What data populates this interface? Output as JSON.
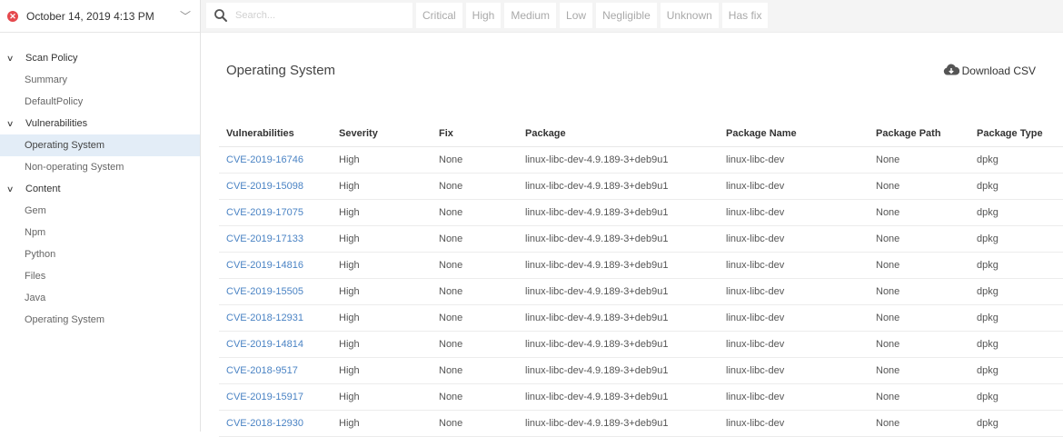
{
  "sidebar": {
    "scan_date": "October 14, 2019 4:13 PM",
    "groups": [
      {
        "label": "Scan Policy",
        "items": [
          "Summary",
          "DefaultPolicy"
        ]
      },
      {
        "label": "Vulnerabilities",
        "items": [
          "Operating System",
          "Non-operating System"
        ]
      },
      {
        "label": "Content",
        "items": [
          "Gem",
          "Npm",
          "Python",
          "Files",
          "Java",
          "Operating System"
        ]
      }
    ],
    "active_item": "Vulnerabilities / Operating System"
  },
  "search": {
    "placeholder": "Search..."
  },
  "filters": [
    "Critical",
    "High",
    "Medium",
    "Low",
    "Negligible",
    "Unknown",
    "Has fix"
  ],
  "main": {
    "title": "Operating System",
    "download_label": "Download CSV"
  },
  "table": {
    "columns": [
      "Vulnerabilities",
      "Severity",
      "Fix",
      "Package",
      "Package Name",
      "Package Path",
      "Package Type"
    ],
    "rows": [
      [
        "CVE-2019-16746",
        "High",
        "None",
        "linux-libc-dev-4.9.189-3+deb9u1",
        "linux-libc-dev",
        "None",
        "dpkg"
      ],
      [
        "CVE-2019-15098",
        "High",
        "None",
        "linux-libc-dev-4.9.189-3+deb9u1",
        "linux-libc-dev",
        "None",
        "dpkg"
      ],
      [
        "CVE-2019-17075",
        "High",
        "None",
        "linux-libc-dev-4.9.189-3+deb9u1",
        "linux-libc-dev",
        "None",
        "dpkg"
      ],
      [
        "CVE-2019-17133",
        "High",
        "None",
        "linux-libc-dev-4.9.189-3+deb9u1",
        "linux-libc-dev",
        "None",
        "dpkg"
      ],
      [
        "CVE-2019-14816",
        "High",
        "None",
        "linux-libc-dev-4.9.189-3+deb9u1",
        "linux-libc-dev",
        "None",
        "dpkg"
      ],
      [
        "CVE-2019-15505",
        "High",
        "None",
        "linux-libc-dev-4.9.189-3+deb9u1",
        "linux-libc-dev",
        "None",
        "dpkg"
      ],
      [
        "CVE-2018-12931",
        "High",
        "None",
        "linux-libc-dev-4.9.189-3+deb9u1",
        "linux-libc-dev",
        "None",
        "dpkg"
      ],
      [
        "CVE-2019-14814",
        "High",
        "None",
        "linux-libc-dev-4.9.189-3+deb9u1",
        "linux-libc-dev",
        "None",
        "dpkg"
      ],
      [
        "CVE-2018-9517",
        "High",
        "None",
        "linux-libc-dev-4.9.189-3+deb9u1",
        "linux-libc-dev",
        "None",
        "dpkg"
      ],
      [
        "CVE-2019-15917",
        "High",
        "None",
        "linux-libc-dev-4.9.189-3+deb9u1",
        "linux-libc-dev",
        "None",
        "dpkg"
      ],
      [
        "CVE-2018-12930",
        "High",
        "None",
        "linux-libc-dev-4.9.189-3+deb9u1",
        "linux-libc-dev",
        "None",
        "dpkg"
      ]
    ]
  },
  "colors": {
    "link": "#4a83c4",
    "active_nav_bg": "#e3edf7",
    "error_icon": "#e5484d",
    "filter_text": "#a9a9a9"
  }
}
